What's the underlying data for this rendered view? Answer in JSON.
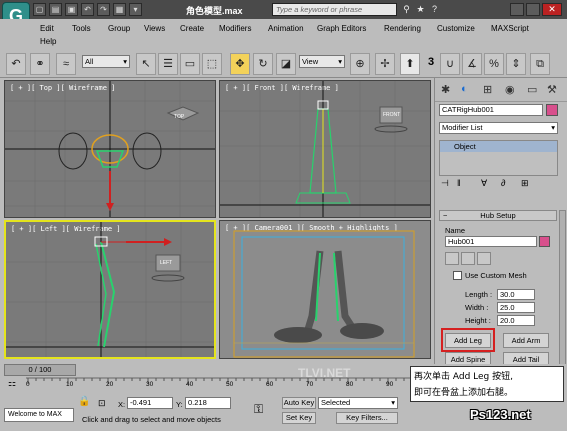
{
  "title_bar": {
    "file_title": "角色模型.max",
    "search_placeholder": "Type a keyword or phrase"
  },
  "menu": {
    "items": [
      "Edit",
      "Tools",
      "Group",
      "Views",
      "Create",
      "Modifiers",
      "Animation",
      "Graph Editors",
      "Rendering",
      "Customize",
      "MAXScript",
      "Help"
    ]
  },
  "toolbar": {
    "filter_dropdown": "All",
    "coord_dropdown": "View",
    "snap_value": "3"
  },
  "viewports": {
    "top": {
      "label": "[ + ][ Top ][ Wireframe ]",
      "cube": "TOP"
    },
    "front": {
      "label": "[ + ][ Front ][ Wireframe ]",
      "cube": "FRONT"
    },
    "left": {
      "label": "[ + ][ Left ][ Wireframe ]",
      "cube": "LEFT"
    },
    "camera": {
      "label": "[ + ][ Camera001 ][ Smooth + Highlights ]"
    }
  },
  "command_panel": {
    "object_name": "CATRigHub001",
    "color_swatch": "#d84f8c",
    "modifier_list": "Modifier List",
    "stack_item": "Object",
    "rollout_title": "Hub Setup",
    "name_label": "Name",
    "name_value": "Hub001",
    "custom_mesh_label": "Use Custom Mesh",
    "length_label": "Length :",
    "length_value": "30.0",
    "width_label": "Width :",
    "width_value": "25.0",
    "height_label": "Height :",
    "height_value": "20.0",
    "add_leg": "Add Leg",
    "add_arm": "Add Arm",
    "add_spine": "Add Spine",
    "add_tail": "Add Tail"
  },
  "timeline": {
    "frame_counter": "0 / 100",
    "ticks": [
      "0",
      "10",
      "20",
      "30",
      "40",
      "50",
      "60",
      "70",
      "80",
      "90",
      "100"
    ]
  },
  "status": {
    "maxscript_text": "Welcome to MAX",
    "x_label": "X:",
    "x_value": "-0.491",
    "y_label": "Y:",
    "y_value": "0.218",
    "prompt": "Click and drag to select and move objects",
    "auto_key": "Auto Key",
    "selected": "Selected",
    "set_key": "Set Key",
    "key_filters": "Key Filters..."
  },
  "overlay": {
    "callout_line1": "再次单击 Add Leg 按钮,",
    "callout_line2": "即可在骨盆上添加右腿。",
    "watermark_site": "Ps123.net",
    "watermark_bg": "TLVI.NET"
  }
}
